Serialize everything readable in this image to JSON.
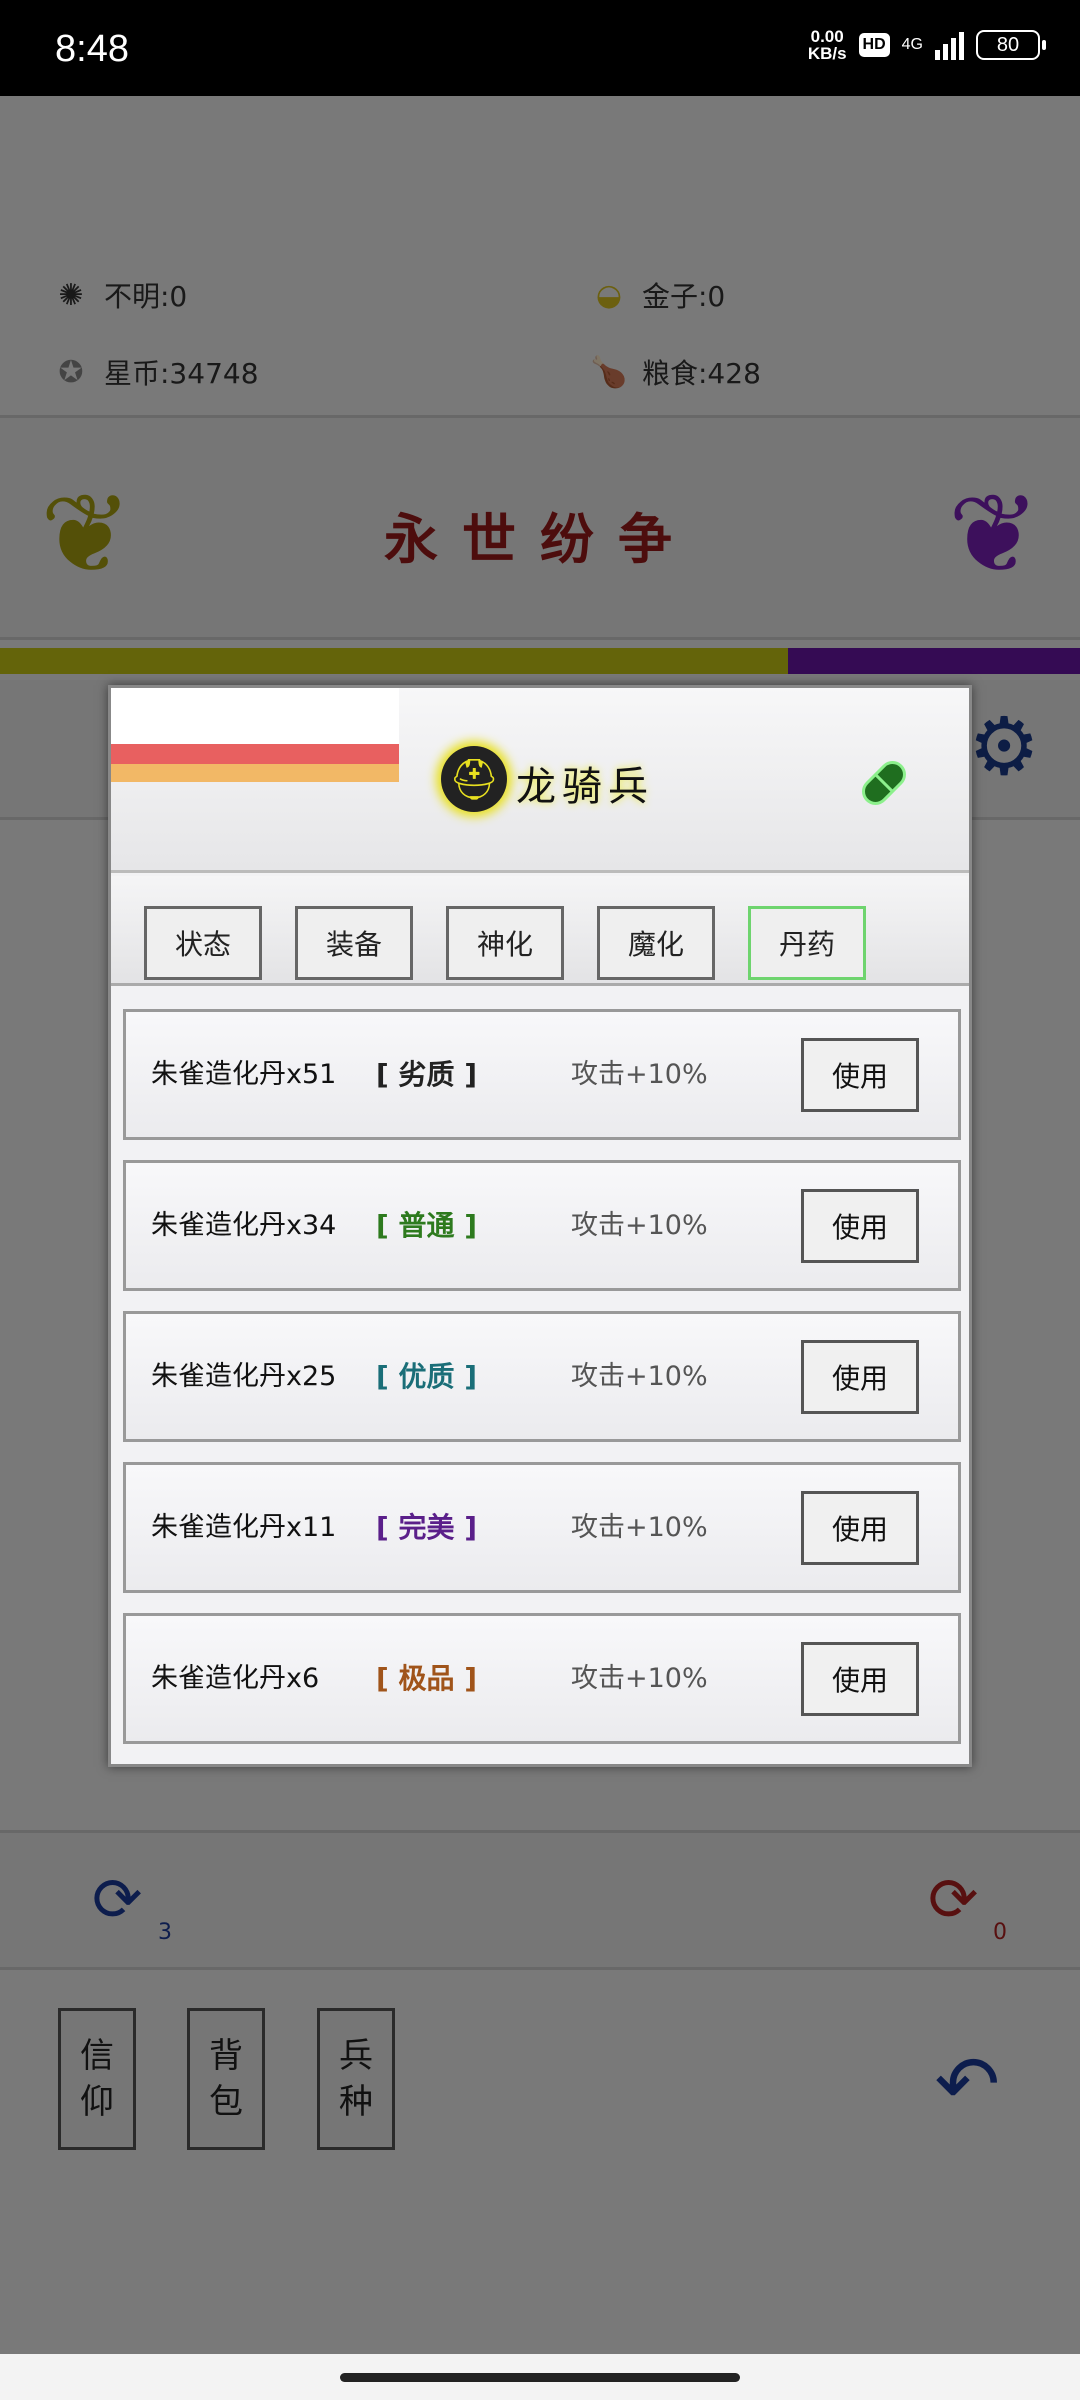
{
  "status_bar": {
    "time": "8:48",
    "net_speed_value": "0.00",
    "net_speed_unit": "KB/s",
    "hd_label": "HD",
    "network_type": "4G",
    "battery": "80"
  },
  "resources": {
    "unknown": "不明:0",
    "gold": "金子:0",
    "star_coin": "星币:34748",
    "food": "粮食:428"
  },
  "game_title": "永世纷争",
  "progress": {
    "fraction": 0.73,
    "fill_color": "#c8c814",
    "rest_color": "#6b16a8"
  },
  "dialog": {
    "unit_name": "龙骑兵",
    "tabs": [
      {
        "label": "状态",
        "active": false
      },
      {
        "label": "装备",
        "active": false
      },
      {
        "label": "神化",
        "active": false
      },
      {
        "label": "魔化",
        "active": false
      },
      {
        "label": "丹药",
        "active": true
      }
    ],
    "items": [
      {
        "name": "朱雀造化丹x51",
        "quality": "[ 劣质 ]",
        "quality_color": "#222222",
        "effect": "攻击+10%",
        "button": "使用"
      },
      {
        "name": "朱雀造化丹x34",
        "quality": "[ 普通 ]",
        "quality_color": "#2d7a1e",
        "effect": "攻击+10%",
        "button": "使用"
      },
      {
        "name": "朱雀造化丹x25",
        "quality": "[ 优质 ]",
        "quality_color": "#1a6e78",
        "effect": "攻击+10%",
        "button": "使用"
      },
      {
        "name": "朱雀造化丹x11",
        "quality": "[ 完美 ]",
        "quality_color": "#5a1f8a",
        "effect": "攻击+10%",
        "button": "使用"
      },
      {
        "name": "朱雀造化丹x6",
        "quality": "[ 极品 ]",
        "quality_color": "#a0541a",
        "effect": "攻击+10%",
        "button": "使用"
      }
    ]
  },
  "refresh": {
    "left_count": "3",
    "right_count": "0"
  },
  "side_buttons": [
    {
      "line1": "信",
      "line2": "仰"
    },
    {
      "line1": "背",
      "line2": "包"
    },
    {
      "line1": "兵",
      "line2": "种"
    }
  ]
}
